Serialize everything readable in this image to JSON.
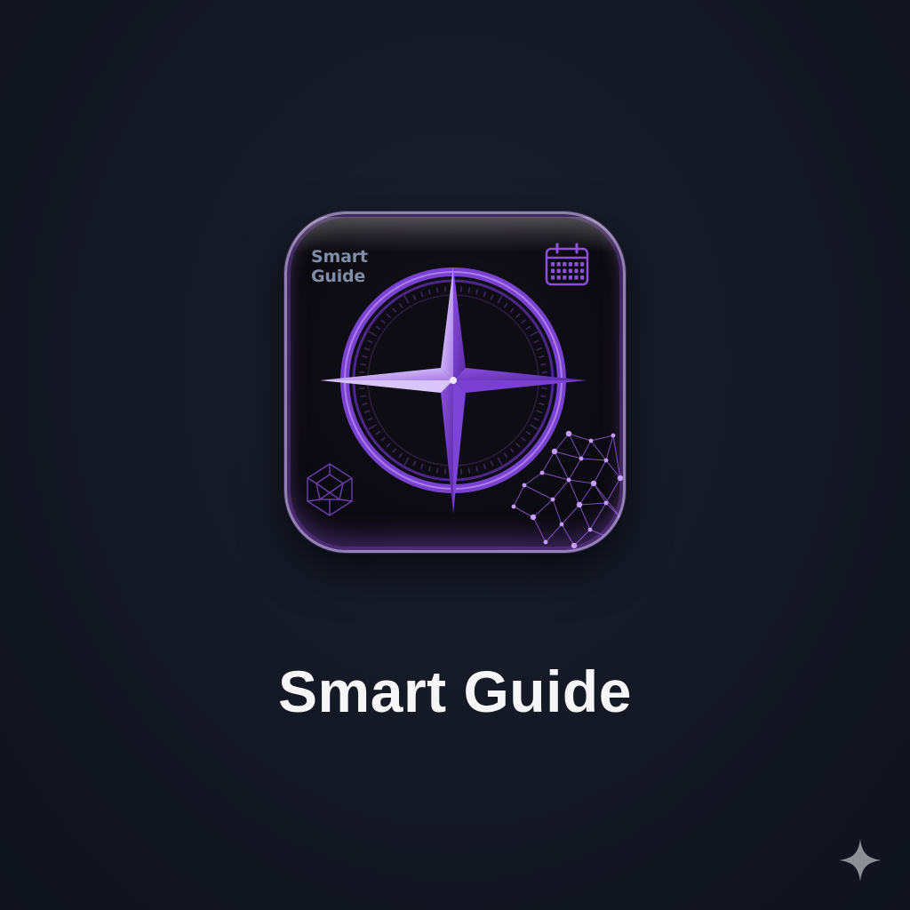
{
  "icon": {
    "caption_line1": "Smart",
    "caption_line2": "Guide",
    "accent_color": "#8b4fd8",
    "glow_color": "#b07cff",
    "caption_color": "#7f8da6"
  },
  "app": {
    "title": "Smart Guide"
  },
  "icons": {
    "compass": "compass-rose-icon",
    "calendar": "calendar-icon",
    "network": "network-nodes-icon",
    "gem": "gem-wireframe-icon",
    "sparkle": "sparkle-icon"
  },
  "background_color": "#151926"
}
